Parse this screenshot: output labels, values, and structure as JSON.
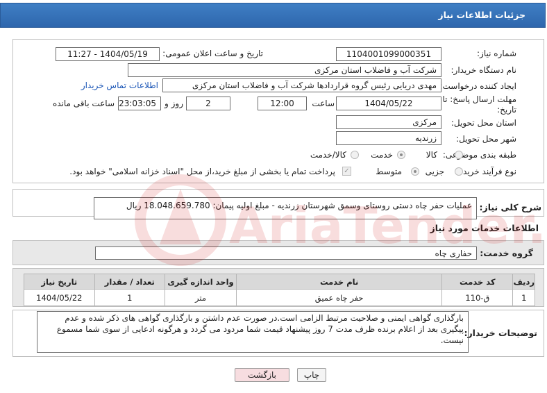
{
  "header": {
    "title": "جزئیات اطلاعات نیاز"
  },
  "form": {
    "need_number_label": "شماره نیاز:",
    "need_number": "1104001099000351",
    "announce_label": "تاریخ و ساعت اعلان عمومی:",
    "announce_value": "1404/05/19 - 11:27",
    "buyer_org_label": "نام دستگاه خریدار:",
    "buyer_org": "شرکت آب و فاضلاب استان مرکزی",
    "creator_label": "ایجاد کننده درخواست:",
    "creator": "مهدی دریایی رئیس گروه قراردادها شرکت آب و فاضلاب استان مرکزی",
    "contact_link": "اطلاعات تماس خریدار",
    "deadline_label_1": "مهلت ارسال پاسخ: تا",
    "deadline_label_2": "تاریخ:",
    "deadline_date": "1404/05/22",
    "time_label": "ساعت",
    "deadline_time": "12:00",
    "days_value": "2",
    "days_label": "روز و",
    "remaining_time": "23:03:05",
    "remaining_label": "ساعت باقی مانده",
    "province_label": "استان محل تحویل:",
    "province": "مرکزی",
    "city_label": "شهر محل تحویل:",
    "city": "زرندیه",
    "category_label": "طبقه بندی موضوعی:",
    "category_options": [
      "کالا",
      "خدمت",
      "کالا/خدمت"
    ],
    "category_selected": "خدمت",
    "process_label": "نوع فرآیند خرید :",
    "process_options": [
      "جزیی",
      "متوسط"
    ],
    "process_selected": "متوسط",
    "payment_note": "پرداخت تمام یا بخشی از مبلغ خرید،از محل \"اسناد خزانه اسلامی\" خواهد بود."
  },
  "description": {
    "label": "شرح کلی نیاز:",
    "text": "عملیات حفر چاه دستی روستای وسمق شهرستان زرندیه - مبلغ اولیه پیمان: 18.048.659.780 ریال"
  },
  "services": {
    "section_title": "اطلاعات خدمات مورد نیاز",
    "group_label": "گروه خدمت:",
    "group_value": "حفاری چاه",
    "columns": [
      "ردیف",
      "کد خدمت",
      "نام خدمت",
      "واحد اندازه گیری",
      "تعداد / مقدار",
      "تاریخ نیاز"
    ],
    "rows": [
      [
        "1",
        "ق-110",
        "حفر چاه عمیق",
        "متر",
        "1",
        "1404/05/22"
      ]
    ]
  },
  "buyer_notes": {
    "label": "توضیحات خریدار:",
    "text": "بارگذاری گواهی ایمنی و صلاحیت مرتبط الزامی است.در صورت عدم داشتن و بارگذاری گواهی های ذکر شده و عدم پیگیری بعد از اعلام برنده ظرف مدت 7 روز پیشنهاد قیمت شما مردود می گردد و هرگونه ادعایی از سوی شما مسموع نیست."
  },
  "buttons": {
    "print": "چاپ",
    "back": "بازگشت"
  },
  "watermark": {
    "text": "AriaTender.net"
  },
  "colors": {
    "header": "#2e66ad",
    "link": "#1a55b6",
    "back_button": "#f7dde0"
  }
}
